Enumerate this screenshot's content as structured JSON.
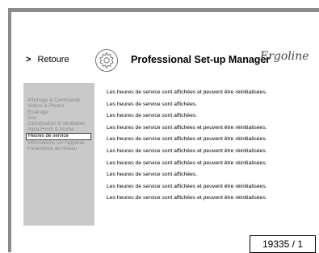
{
  "header": {
    "back_label": "Retoure",
    "title": "Professional Set-up Manager",
    "brand": "Ergoline"
  },
  "sidebar": {
    "items": [
      {
        "label": "Affichage & Commande",
        "active": false
      },
      {
        "label": "Vidéos & Photos",
        "active": false
      },
      {
        "label": "Éclairage",
        "active": false
      },
      {
        "label": "Son",
        "active": false
      },
      {
        "label": "Climatisation & Ventilation",
        "active": false
      },
      {
        "label": "Aqua Fresh & Aroma",
        "active": false
      },
      {
        "label": "Heures de service",
        "active": true
      },
      {
        "label": "Informations sur l'appareil",
        "active": false
      },
      {
        "label": "Paramètres du réseau",
        "active": false
      }
    ]
  },
  "content": {
    "lines": [
      "Les heures de service sont affichées et peuvent être réinitialisées.",
      "Les heures de service sont affichées.",
      "Les heures de service sont affichées.",
      "Les heures de service sont affichées et peuvent être réinitialisées.",
      "Les heures de service sont affichées et peuvent être réinitialisées.",
      "Les heures de service sont affichées et peuvent être réinitialisées.",
      "Les heures de service sont affichées et peuvent être réinitialisées.",
      "Les heures de service sont affichées.",
      "Les heures de service sont affichées et peuvent être réinitialisées.",
      "Les heures de service sont affichées et peuvent être réinitialisées."
    ]
  },
  "page_counter": "19335 / 1",
  "icons": {
    "back": "chevron-right-icon",
    "settings": "gear-icon"
  },
  "colors": {
    "frame": "#8c8c8c",
    "sidebar_bg": "#c9c9c9",
    "sidebar_text": "#8a8a8a"
  }
}
